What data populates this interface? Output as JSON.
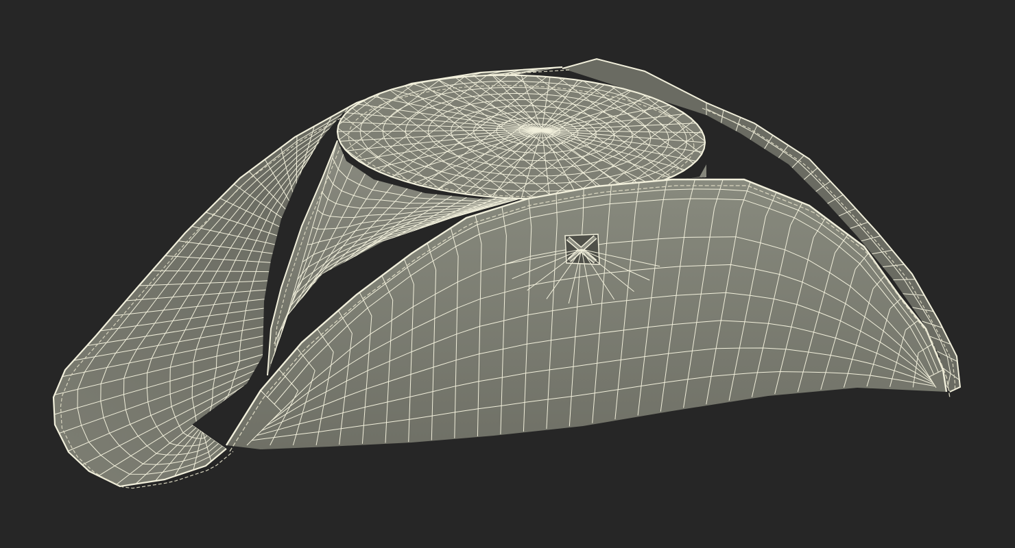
{
  "scene": {
    "subject": "tricorn-hat-wireframe",
    "background_color": "#262626",
    "surface_color": "#7b7c70",
    "surface_shadow_color": "#4f5049",
    "surface_light_color": "#8e8f83",
    "wire_color": "#f2f0dc",
    "stitch_color": "#d9d6c0"
  }
}
